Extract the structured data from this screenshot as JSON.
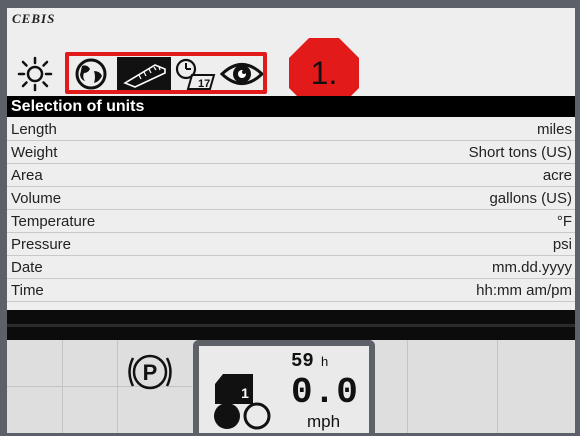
{
  "brand": "CEBIS",
  "icons": {
    "brightness": "sun-icon",
    "tabs": [
      "globe-icon",
      "ruler-icon",
      "clock-calendar-icon",
      "eye-icon"
    ],
    "parking": "parking-brake-icon",
    "vehicle": "tractor-gear-icon"
  },
  "callout": {
    "label": "1."
  },
  "section": {
    "title": "Selection of units"
  },
  "units": [
    {
      "name": "Length",
      "value": "miles"
    },
    {
      "name": "Weight",
      "value": "Short tons (US)"
    },
    {
      "name": "Area",
      "value": "acre"
    },
    {
      "name": "Volume",
      "value": "gallons (US)"
    },
    {
      "name": "Temperature",
      "value": "°F"
    },
    {
      "name": "Pressure",
      "value": "psi"
    },
    {
      "name": "Date",
      "value": "mm.dd.yyyy"
    },
    {
      "name": "Time",
      "value": "hh:mm am/pm"
    }
  ],
  "status": {
    "engine_hours": "59",
    "engine_hours_unit": "h",
    "speed": "0.0",
    "speed_unit": "mph",
    "gear": "1"
  },
  "colors": {
    "highlight": "#e21a1a",
    "badge": "#e21a1a",
    "header": "#000000"
  }
}
